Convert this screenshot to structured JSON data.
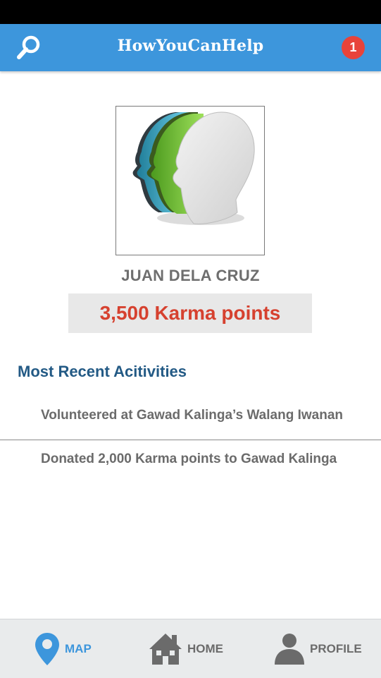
{
  "app": {
    "title": "HowYouCanHelp",
    "notification_count": "1"
  },
  "icons": {
    "search": "search-icon",
    "avatar": "profile-heads-image",
    "map": "map-pin-icon",
    "home": "house-icon",
    "profile": "person-icon"
  },
  "colors": {
    "primary": "#3d96dc",
    "badge": "#e8433a",
    "karma": "#d6412f",
    "section_title": "#235a85",
    "nav_active": "#3d96dc",
    "nav_inactive": "#6b6b6b"
  },
  "profile": {
    "name": "JUAN DELA CRUZ",
    "karma": "3,500 Karma points"
  },
  "activities": {
    "title": "Most Recent Acitivities",
    "items": [
      {
        "text": "Volunteered at Gawad Kalinga’s Walang Iwanan"
      },
      {
        "text": "Donated 2,000 Karma points to Gawad Kalinga"
      }
    ]
  },
  "nav": {
    "items": [
      {
        "label": "MAP",
        "active": true
      },
      {
        "label": "HOME",
        "active": false
      },
      {
        "label": "PROFILE",
        "active": false
      }
    ]
  }
}
